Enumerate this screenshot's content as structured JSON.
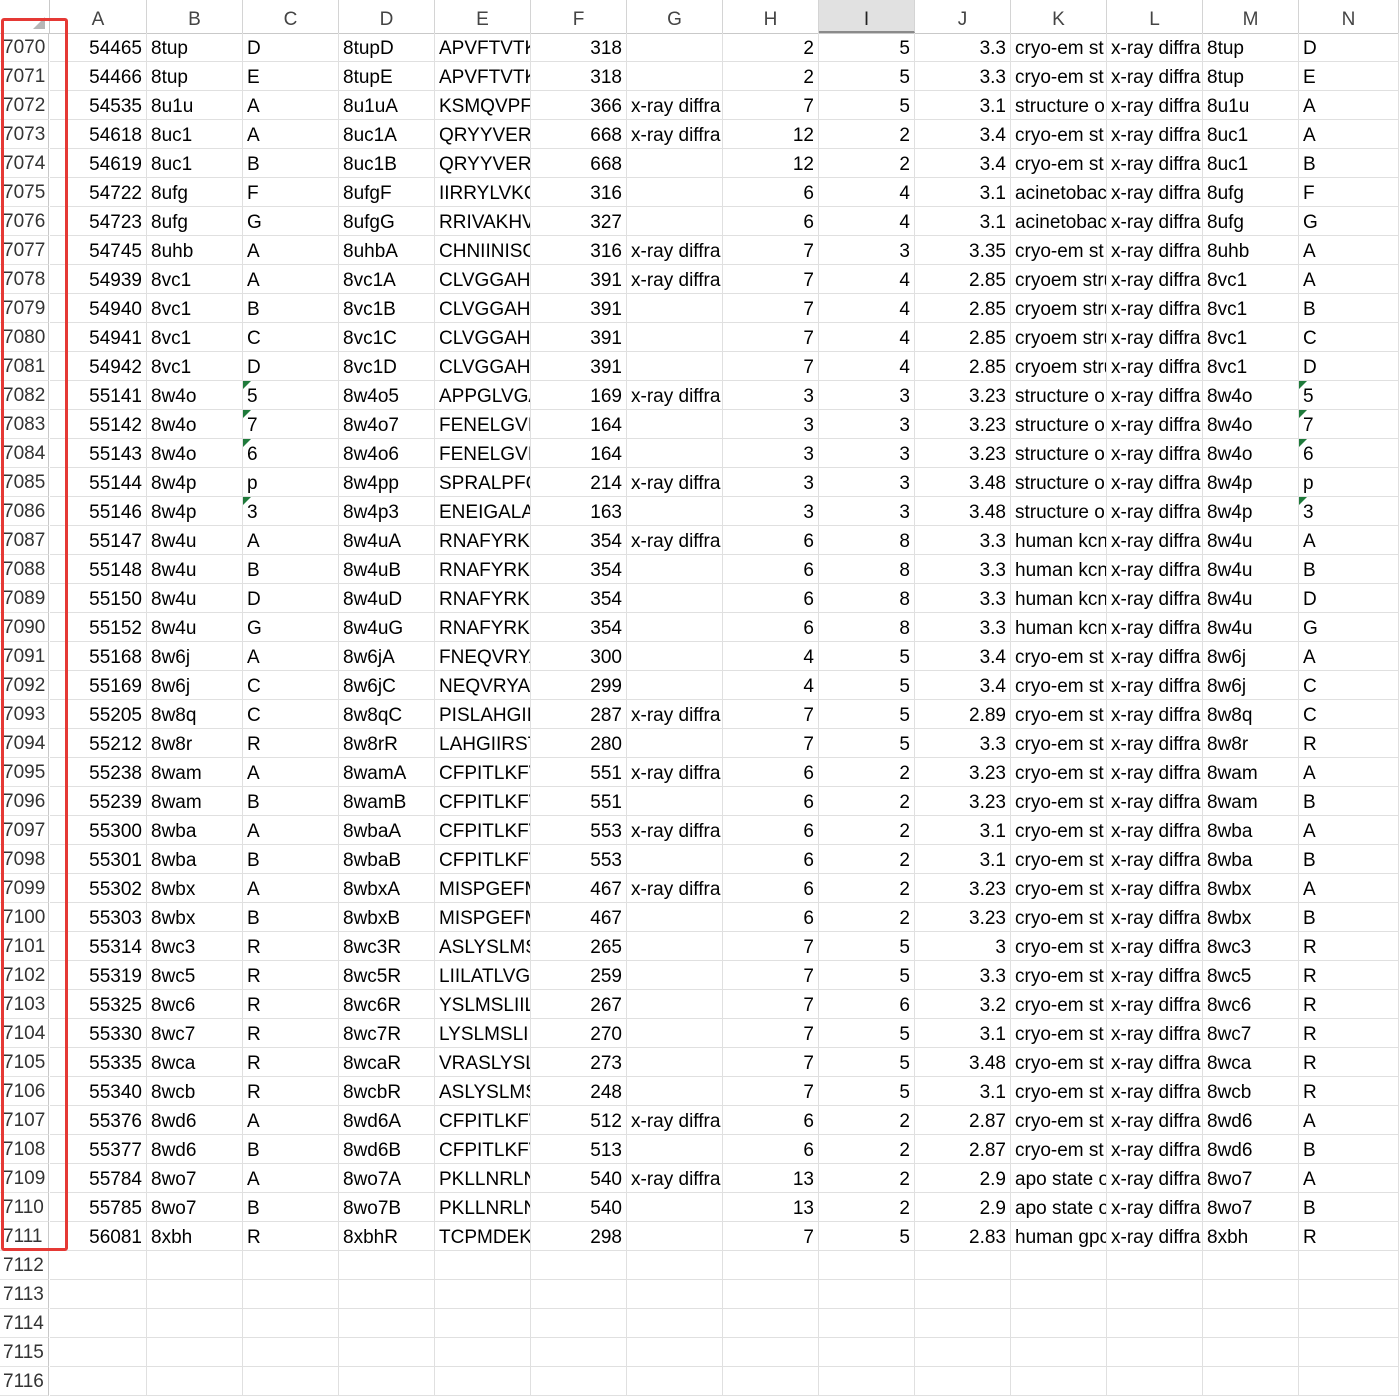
{
  "columns": [
    "A",
    "B",
    "C",
    "D",
    "E",
    "F",
    "G",
    "H",
    "I",
    "J",
    "K",
    "L",
    "M",
    "N"
  ],
  "selected_column": "I",
  "rows": [
    {
      "n": "7070",
      "c": [
        "54465",
        "8tup",
        "D",
        "8tupD",
        "APVFTVTK",
        "318",
        "",
        "2",
        "5",
        "3.3",
        "cryo-em st",
        "x-ray diffra",
        "8tup",
        "D"
      ]
    },
    {
      "n": "7071",
      "c": [
        "54466",
        "8tup",
        "E",
        "8tupE",
        "APVFTVTK",
        "318",
        "",
        "2",
        "5",
        "3.3",
        "cryo-em st",
        "x-ray diffra",
        "8tup",
        "E"
      ]
    },
    {
      "n": "7072",
      "c": [
        "54535",
        "8u1u",
        "A",
        "8u1uA",
        "KSMQVPFS",
        "366",
        "x-ray diffra",
        "7",
        "5",
        "3.1",
        "structure o",
        "x-ray diffra",
        "8u1u",
        "A"
      ]
    },
    {
      "n": "7073",
      "c": [
        "54618",
        "8uc1",
        "A",
        "8uc1A",
        "QRYYVERF",
        "668",
        "x-ray diffra",
        "12",
        "2",
        "3.4",
        "cryo-em st",
        "x-ray diffra",
        "8uc1",
        "A"
      ]
    },
    {
      "n": "7074",
      "c": [
        "54619",
        "8uc1",
        "B",
        "8uc1B",
        "QRYYVERF",
        "668",
        "",
        "12",
        "2",
        "3.4",
        "cryo-em st",
        "x-ray diffra",
        "8uc1",
        "B"
      ]
    },
    {
      "n": "7075",
      "c": [
        "54722",
        "8ufg",
        "F",
        "8ufgF",
        "IIRRYLVKQ",
        "316",
        "",
        "6",
        "4",
        "3.1",
        "acinetobac",
        "x-ray diffra",
        "8ufg",
        "F"
      ]
    },
    {
      "n": "7076",
      "c": [
        "54723",
        "8ufg",
        "G",
        "8ufgG",
        "RRIVAKHV",
        "327",
        "",
        "6",
        "4",
        "3.1",
        "acinetobac",
        "x-ray diffra",
        "8ufg",
        "G"
      ]
    },
    {
      "n": "7077",
      "c": [
        "54745",
        "8uhb",
        "A",
        "8uhbA",
        "CHNIINISC",
        "316",
        "x-ray diffra",
        "7",
        "3",
        "3.35",
        "cryo-em st",
        "x-ray diffra",
        "8uhb",
        "A"
      ]
    },
    {
      "n": "7078",
      "c": [
        "54939",
        "8vc1",
        "A",
        "8vc1A",
        "CLVGGAHA",
        "391",
        "x-ray diffra",
        "7",
        "4",
        "2.85",
        "cryoem stru",
        "x-ray diffra",
        "8vc1",
        "A"
      ]
    },
    {
      "n": "7079",
      "c": [
        "54940",
        "8vc1",
        "B",
        "8vc1B",
        "CLVGGAHA",
        "391",
        "",
        "7",
        "4",
        "2.85",
        "cryoem stru",
        "x-ray diffra",
        "8vc1",
        "B"
      ]
    },
    {
      "n": "7080",
      "c": [
        "54941",
        "8vc1",
        "C",
        "8vc1C",
        "CLVGGAHA",
        "391",
        "",
        "7",
        "4",
        "2.85",
        "cryoem stru",
        "x-ray diffra",
        "8vc1",
        "C"
      ]
    },
    {
      "n": "7081",
      "c": [
        "54942",
        "8vc1",
        "D",
        "8vc1D",
        "CLVGGAHA",
        "391",
        "",
        "7",
        "4",
        "2.85",
        "cryoem stru",
        "x-ray diffra",
        "8vc1",
        "D"
      ]
    },
    {
      "n": "7082",
      "c": [
        "55141",
        "8w4o",
        "5",
        "8w4o5",
        "APPGLVGA",
        "169",
        "x-ray diffra",
        "3",
        "3",
        "3.23",
        "structure o",
        "x-ray diffra",
        "8w4o",
        "5"
      ],
      "tri": true
    },
    {
      "n": "7083",
      "c": [
        "55142",
        "8w4o",
        "7",
        "8w4o7",
        "FENELGVIA",
        "164",
        "",
        "3",
        "3",
        "3.23",
        "structure o",
        "x-ray diffra",
        "8w4o",
        "7"
      ],
      "tri": true
    },
    {
      "n": "7084",
      "c": [
        "55143",
        "8w4o",
        "6",
        "8w4o6",
        "FENELGVIA",
        "164",
        "",
        "3",
        "3",
        "3.23",
        "structure o",
        "x-ray diffra",
        "8w4o",
        "6"
      ],
      "tri": true
    },
    {
      "n": "7085",
      "c": [
        "55144",
        "8w4p",
        "p",
        "8w4pp",
        "SPRALPFGS",
        "214",
        "x-ray diffra",
        "3",
        "3",
        "3.48",
        "structure o",
        "x-ray diffra",
        "8w4p",
        "p"
      ]
    },
    {
      "n": "7086",
      "c": [
        "55146",
        "8w4p",
        "3",
        "8w4p3",
        "ENEIGALA",
        "163",
        "",
        "3",
        "3",
        "3.48",
        "structure o",
        "x-ray diffra",
        "8w4p",
        "3"
      ],
      "tri": true
    },
    {
      "n": "7087",
      "c": [
        "55147",
        "8w4u",
        "A",
        "8w4uA",
        "RNAFYRKL",
        "354",
        "x-ray diffra",
        "6",
        "8",
        "3.3",
        "human kcn",
        "x-ray diffra",
        "8w4u",
        "A"
      ]
    },
    {
      "n": "7088",
      "c": [
        "55148",
        "8w4u",
        "B",
        "8w4uB",
        "RNAFYRKL",
        "354",
        "",
        "6",
        "8",
        "3.3",
        "human kcn",
        "x-ray diffra",
        "8w4u",
        "B"
      ]
    },
    {
      "n": "7089",
      "c": [
        "55150",
        "8w4u",
        "D",
        "8w4uD",
        "RNAFYRKL",
        "354",
        "",
        "6",
        "8",
        "3.3",
        "human kcn",
        "x-ray diffra",
        "8w4u",
        "D"
      ]
    },
    {
      "n": "7090",
      "c": [
        "55152",
        "8w4u",
        "G",
        "8w4uG",
        "RNAFYRKL",
        "354",
        "",
        "6",
        "8",
        "3.3",
        "human kcn",
        "x-ray diffra",
        "8w4u",
        "G"
      ]
    },
    {
      "n": "7091",
      "c": [
        "55168",
        "8w6j",
        "A",
        "8w6jA",
        "FNEQVRYA",
        "300",
        "",
        "4",
        "5",
        "3.4",
        "cryo-em st",
        "x-ray diffra",
        "8w6j",
        "A"
      ]
    },
    {
      "n": "7092",
      "c": [
        "55169",
        "8w6j",
        "C",
        "8w6jC",
        "NEQVRYAI",
        "299",
        "",
        "4",
        "5",
        "3.4",
        "cryo-em st",
        "x-ray diffra",
        "8w6j",
        "C"
      ]
    },
    {
      "n": "7093",
      "c": [
        "55205",
        "8w8q",
        "C",
        "8w8qC",
        "PISLAHGIII",
        "287",
        "x-ray diffra",
        "7",
        "5",
        "2.89",
        "cryo-em st",
        "x-ray diffra",
        "8w8q",
        "C"
      ]
    },
    {
      "n": "7094",
      "c": [
        "55212",
        "8w8r",
        "R",
        "8w8rR",
        "LAHGIIRST",
        "280",
        "",
        "7",
        "5",
        "3.3",
        "cryo-em st",
        "x-ray diffra",
        "8w8r",
        "R"
      ]
    },
    {
      "n": "7095",
      "c": [
        "55238",
        "8wam",
        "A",
        "8wamA",
        "CFPITLKFV",
        "551",
        "x-ray diffra",
        "6",
        "2",
        "3.23",
        "cryo-em st",
        "x-ray diffra",
        "8wam",
        "A"
      ]
    },
    {
      "n": "7096",
      "c": [
        "55239",
        "8wam",
        "B",
        "8wamB",
        "CFPITLKFV",
        "551",
        "",
        "6",
        "2",
        "3.23",
        "cryo-em st",
        "x-ray diffra",
        "8wam",
        "B"
      ]
    },
    {
      "n": "7097",
      "c": [
        "55300",
        "8wba",
        "A",
        "8wbaA",
        "CFPITLKFV",
        "553",
        "x-ray diffra",
        "6",
        "2",
        "3.1",
        "cryo-em st",
        "x-ray diffra",
        "8wba",
        "A"
      ]
    },
    {
      "n": "7098",
      "c": [
        "55301",
        "8wba",
        "B",
        "8wbaB",
        "CFPITLKFV",
        "553",
        "",
        "6",
        "2",
        "3.1",
        "cryo-em st",
        "x-ray diffra",
        "8wba",
        "B"
      ]
    },
    {
      "n": "7099",
      "c": [
        "55302",
        "8wbx",
        "A",
        "8wbxA",
        "MISPGEFM",
        "467",
        "x-ray diffra",
        "6",
        "2",
        "3.23",
        "cryo-em st",
        "x-ray diffra",
        "8wbx",
        "A"
      ]
    },
    {
      "n": "7100",
      "c": [
        "55303",
        "8wbx",
        "B",
        "8wbxB",
        "MISPGEFM",
        "467",
        "",
        "6",
        "2",
        "3.23",
        "cryo-em st",
        "x-ray diffra",
        "8wbx",
        "B"
      ]
    },
    {
      "n": "7101",
      "c": [
        "55314",
        "8wc3",
        "R",
        "8wc3R",
        "ASLYSLMS",
        "265",
        "",
        "7",
        "5",
        "3",
        "cryo-em st",
        "x-ray diffra",
        "8wc3",
        "R"
      ]
    },
    {
      "n": "7102",
      "c": [
        "55319",
        "8wc5",
        "R",
        "8wc5R",
        "LIILATLVGI",
        "259",
        "",
        "7",
        "5",
        "3.3",
        "cryo-em st",
        "x-ray diffra",
        "8wc5",
        "R"
      ]
    },
    {
      "n": "7103",
      "c": [
        "55325",
        "8wc6",
        "R",
        "8wc6R",
        "YSLMSLIILA",
        "267",
        "",
        "7",
        "6",
        "3.2",
        "cryo-em st",
        "x-ray diffra",
        "8wc6",
        "R"
      ]
    },
    {
      "n": "7104",
      "c": [
        "55330",
        "8wc7",
        "R",
        "8wc7R",
        "LYSLMSLIII",
        "270",
        "",
        "7",
        "5",
        "3.1",
        "cryo-em st",
        "x-ray diffra",
        "8wc7",
        "R"
      ]
    },
    {
      "n": "7105",
      "c": [
        "55335",
        "8wca",
        "R",
        "8wcaR",
        "VRASLYSLM",
        "273",
        "",
        "7",
        "5",
        "3.48",
        "cryo-em st",
        "x-ray diffra",
        "8wca",
        "R"
      ]
    },
    {
      "n": "7106",
      "c": [
        "55340",
        "8wcb",
        "R",
        "8wcbR",
        "ASLYSLMS",
        "248",
        "",
        "7",
        "5",
        "3.1",
        "cryo-em st",
        "x-ray diffra",
        "8wcb",
        "R"
      ]
    },
    {
      "n": "7107",
      "c": [
        "55376",
        "8wd6",
        "A",
        "8wd6A",
        "CFPITLKFV",
        "512",
        "x-ray diffra",
        "6",
        "2",
        "2.87",
        "cryo-em st",
        "x-ray diffra",
        "8wd6",
        "A"
      ]
    },
    {
      "n": "7108",
      "c": [
        "55377",
        "8wd6",
        "B",
        "8wd6B",
        "CFPITLKFV",
        "513",
        "",
        "6",
        "2",
        "2.87",
        "cryo-em st",
        "x-ray diffra",
        "8wd6",
        "B"
      ]
    },
    {
      "n": "7109",
      "c": [
        "55784",
        "8wo7",
        "A",
        "8wo7A",
        "PKLLNRLNT",
        "540",
        "x-ray diffra",
        "13",
        "2",
        "2.9",
        "apo state o",
        "x-ray diffra",
        "8wo7",
        "A"
      ]
    },
    {
      "n": "7110",
      "c": [
        "55785",
        "8wo7",
        "B",
        "8wo7B",
        "PKLLNRLNT",
        "540",
        "",
        "13",
        "2",
        "2.9",
        "apo state o",
        "x-ray diffra",
        "8wo7",
        "B"
      ]
    },
    {
      "n": "7111",
      "c": [
        "56081",
        "8xbh",
        "R",
        "8xbhR",
        "TCPMDEKI",
        "298",
        "",
        "7",
        "5",
        "2.83",
        "human gpc",
        "x-ray diffra",
        "8xbh",
        "R"
      ]
    },
    {
      "n": "7112",
      "c": [
        "",
        "",
        "",
        "",
        "",
        "",
        "",
        "",
        "",
        "",
        "",
        "",
        "",
        ""
      ]
    },
    {
      "n": "7113",
      "c": [
        "",
        "",
        "",
        "",
        "",
        "",
        "",
        "",
        "",
        "",
        "",
        "",
        "",
        ""
      ]
    },
    {
      "n": "7114",
      "c": [
        "",
        "",
        "",
        "",
        "",
        "",
        "",
        "",
        "",
        "",
        "",
        "",
        "",
        ""
      ]
    },
    {
      "n": "7115",
      "c": [
        "",
        "",
        "",
        "",
        "",
        "",
        "",
        "",
        "",
        "",
        "",
        "",
        "",
        ""
      ]
    },
    {
      "n": "7116",
      "c": [
        "",
        "",
        "",
        "",
        "",
        "",
        "",
        "",
        "",
        "",
        "",
        "",
        "",
        ""
      ]
    }
  ]
}
